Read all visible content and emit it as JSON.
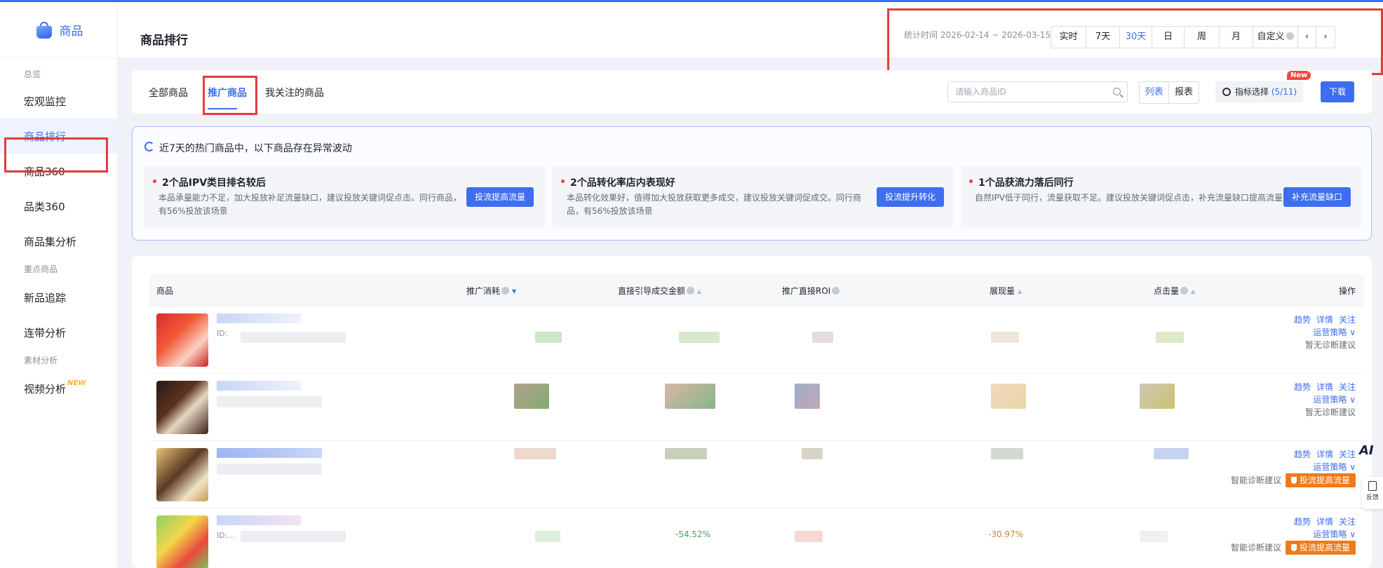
{
  "app": {
    "brand": "商品"
  },
  "sidebar": {
    "groups": [
      "总览",
      "重点商品",
      "素材分析"
    ],
    "items": [
      {
        "label": "宏观监控"
      },
      {
        "label": "商品排行"
      },
      {
        "label": "商品360"
      },
      {
        "label": "品类360"
      },
      {
        "label": "商品集分析"
      },
      {
        "label": "新品追踪"
      },
      {
        "label": "连带分析"
      },
      {
        "label": "视频分析",
        "tag": "NEW"
      }
    ]
  },
  "header": {
    "title": "商品排行",
    "stat_range": "统计时间 2026-02-14 ~ 2026-03-15",
    "time_options": [
      "实时",
      "7天",
      "30天",
      "日",
      "周",
      "月",
      "自定义"
    ],
    "active_time": "30天",
    "prev": "‹",
    "next": "›"
  },
  "tabs": {
    "items": [
      "全部商品",
      "推广商品",
      "我关注的商品"
    ],
    "active": "推广商品",
    "search_placeholder": "请输入商品ID",
    "view_options": [
      "列表",
      "报表"
    ],
    "metric_label": "指标选择",
    "metric_count": "(5/11)",
    "new_badge": "New",
    "download": "下载"
  },
  "alert": {
    "title": "近7天的热门商品中，以下商品存在异常波动",
    "cards": [
      {
        "title": "2个品IPV类目排名较后",
        "desc": "本品承量能力不足，加大投放补足流量缺口，建议投放关键词促点击。同行商品，有56%投放该场景",
        "button": "投流提高流量"
      },
      {
        "title": "2个品转化率店内表现好",
        "desc": "本品转化效果好，值得加大投放获取更多成交，建议投放关键词促成交。同行商品，有56%投放该场景",
        "button": "投流提升转化"
      },
      {
        "title": "1个品获流力落后同行",
        "desc": "自然IPV低于同行，流量获取不足。建议投放关键词促点击，补充流量缺口提高流量",
        "button": "补充流量缺口"
      }
    ]
  },
  "table": {
    "columns": [
      "商品",
      "推广消耗",
      "直接引导成交金额",
      "推广直接ROI",
      "展现量",
      "点击量",
      "操作"
    ],
    "row_id_prefix": "ID:",
    "row_id_ellipsis": "ID:…",
    "actions": {
      "trend": "趋势",
      "detail": "详情",
      "follow": "关注",
      "strategy": "运营策略 ∨",
      "no_suggestion": "暂无诊断建议",
      "smart_suggestion": "智能诊断建议",
      "boost": "投流提高流量"
    },
    "visible_values": {
      "row4_direct": "-54.52%",
      "row4_ctr": "-30.97%"
    }
  },
  "float": {
    "ai": "AI",
    "feedback": "反馈"
  },
  "colors": {
    "primary": "#3d6ef0",
    "highlight_frame": "#e23c3c",
    "orange": "#f07a1a",
    "badge_red": "#f04a3e"
  }
}
